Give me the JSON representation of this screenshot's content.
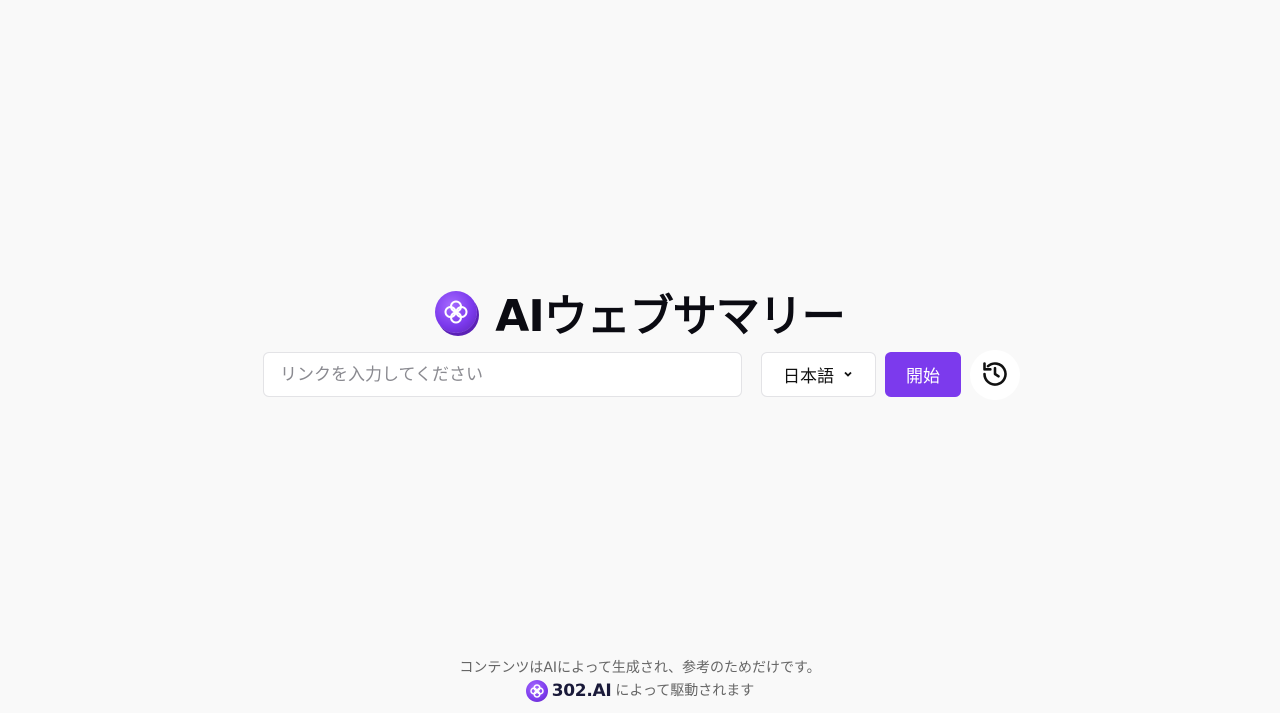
{
  "app": {
    "title": "AIウェブサマリー",
    "logo_icon": "clover-logo-icon",
    "accent_color": "#7c3aed"
  },
  "search": {
    "value": "",
    "placeholder": "リンクを入力してください"
  },
  "language_select": {
    "selected": "日本語",
    "icon": "chevron-down-icon"
  },
  "start_button": {
    "label": "開始"
  },
  "history_button": {
    "icon": "history-icon"
  },
  "footer": {
    "disclaimer": "コンテンツはAIによって生成され、参考のためだけです。",
    "brand": "302.AI",
    "powered_by": "によって駆動されます"
  }
}
